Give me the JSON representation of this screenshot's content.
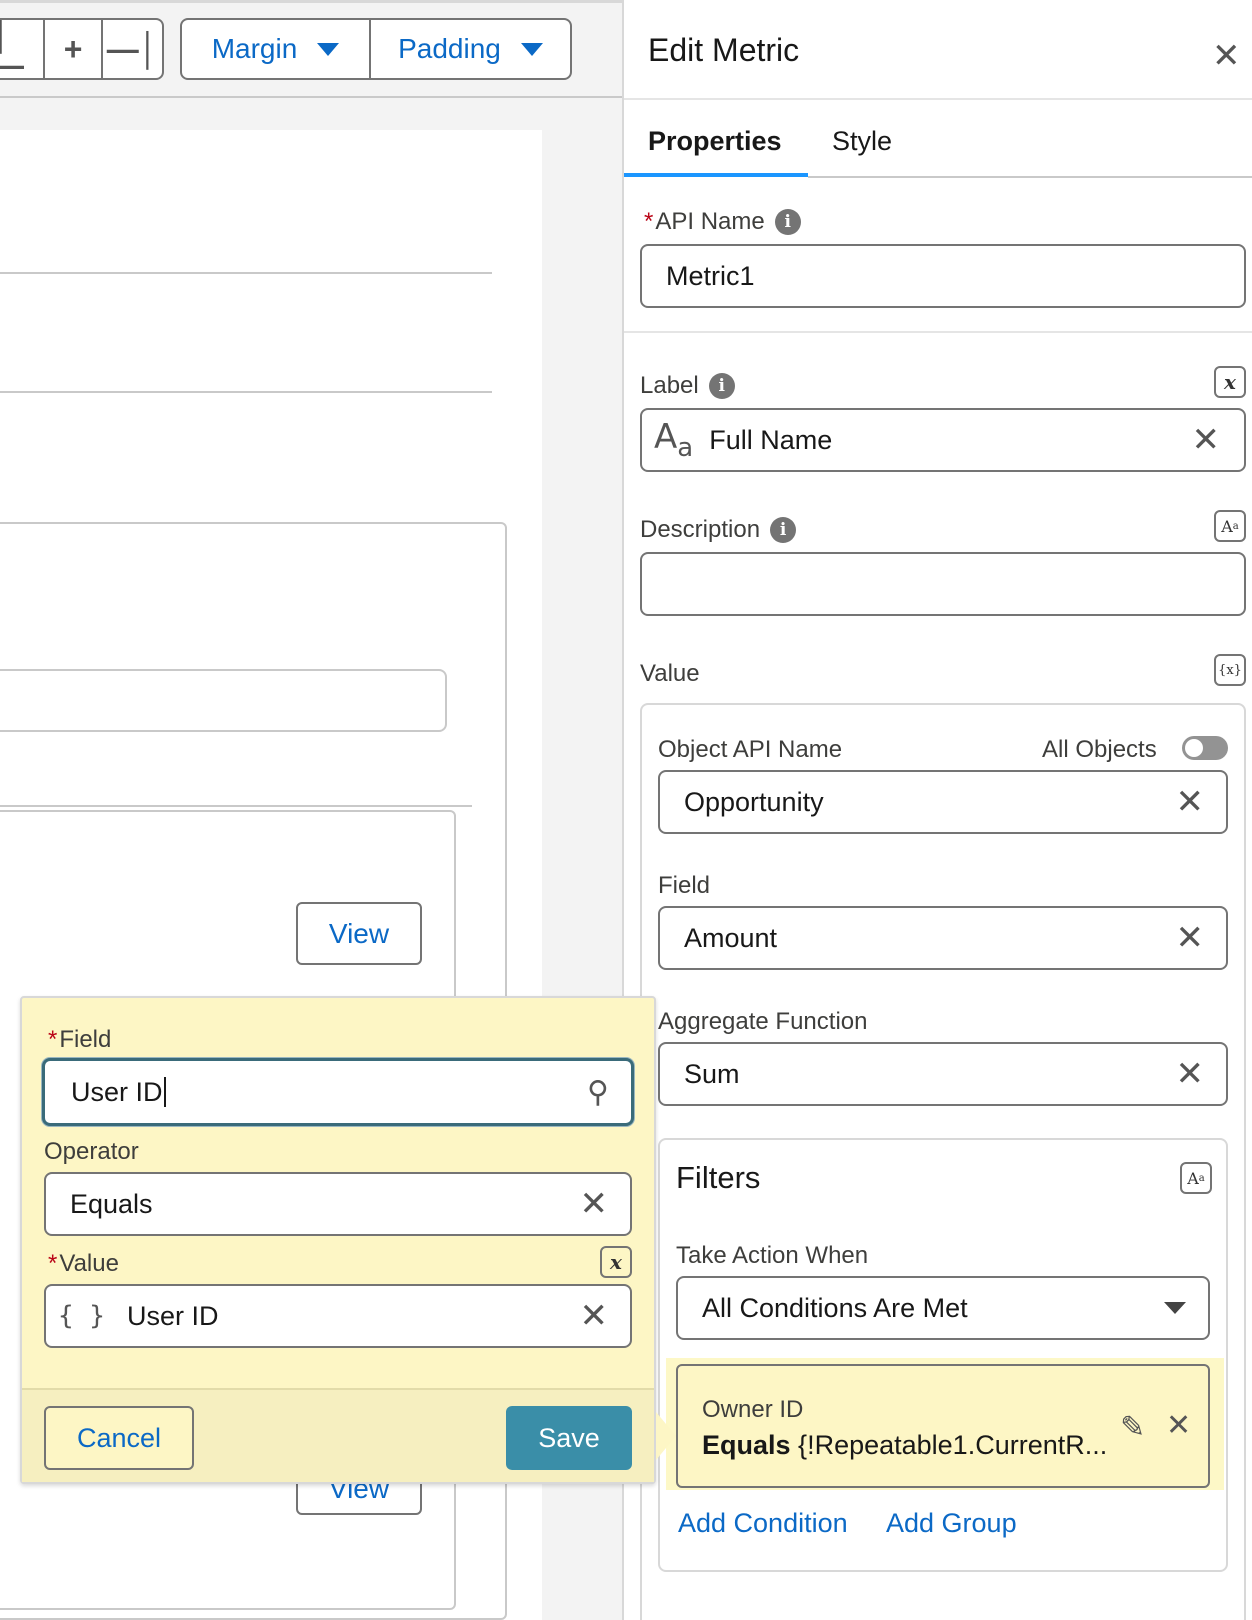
{
  "toolbar": {
    "margin_label": "Margin",
    "padding_label": "Padding",
    "align_left_icon": "align-left-icon",
    "add_icon": "plus-icon",
    "align_right_icon": "align-right-icon"
  },
  "canvas": {
    "view_button_label": "View",
    "view_button_label_partial": "View"
  },
  "panel": {
    "title": "Edit Metric",
    "tabs": [
      {
        "label": "Properties",
        "active": true
      },
      {
        "label": "Style",
        "active": false
      }
    ],
    "api_name": {
      "label": "API Name",
      "required": true,
      "value": "Metric1"
    },
    "label_field": {
      "label": "Label",
      "value": "Full Name",
      "type_icon": "Aa"
    },
    "description": {
      "label": "Description",
      "value": ""
    },
    "value_section": {
      "label": "Value",
      "object_api_name": {
        "label": "Object API Name",
        "value": "Opportunity"
      },
      "all_objects": {
        "label": "All Objects",
        "enabled": false
      },
      "field": {
        "label": "Field",
        "value": "Amount"
      },
      "aggregate_function": {
        "label": "Aggregate Function",
        "value": "Sum"
      },
      "filters": {
        "title": "Filters",
        "take_action_when": {
          "label": "Take Action When",
          "value": "All Conditions Are Met"
        },
        "condition": {
          "field": "Owner ID",
          "operator": "Equals",
          "value": "{!Repeatable1.CurrentR..."
        },
        "add_condition_label": "Add Condition",
        "add_group_label": "Add Group"
      }
    }
  },
  "popover": {
    "field": {
      "label": "Field",
      "required": true,
      "value": "User ID"
    },
    "operator": {
      "label": "Operator",
      "value": "Equals"
    },
    "value": {
      "label": "Value",
      "required": true,
      "value": "User ID",
      "type_icon": "{ }"
    },
    "cancel_label": "Cancel",
    "save_label": "Save"
  },
  "colors": {
    "accent": "#0b69c6",
    "tab_underline": "#1b96ff",
    "save_button": "#3a8ea8",
    "highlight": "#fdf6c5",
    "required": "#ba0517"
  }
}
